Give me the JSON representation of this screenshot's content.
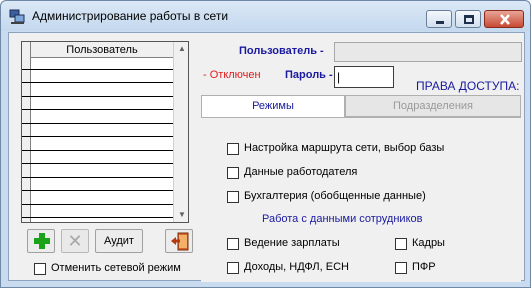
{
  "window": {
    "title": "Администрирование работы в сети"
  },
  "grid": {
    "header": "Пользователь",
    "row_count": 12
  },
  "toolbar": {
    "audit_label": "Аудит"
  },
  "disable_network": {
    "label": "Отменить сетевой режим",
    "checked": false
  },
  "user": {
    "label": "Пользователь -",
    "value": ""
  },
  "status": {
    "text": "- Отключен"
  },
  "password": {
    "label": "Пароль -",
    "value": "|"
  },
  "access": {
    "title": "ПРАВА ДОСТУПА:"
  },
  "tabs": [
    {
      "label": "Режимы",
      "active": true
    },
    {
      "label": "Подразделения",
      "active": false
    }
  ],
  "modes": {
    "items": [
      {
        "label": "Настройка маршрута сети, выбор базы",
        "checked": false
      },
      {
        "label": "Данные работодателя",
        "checked": false
      },
      {
        "label": "Бухгалтерия (обобщенные данные)",
        "checked": false
      }
    ],
    "section": "Работа с данными сотрудников",
    "left": [
      {
        "label": "Ведение зарплаты",
        "checked": false
      },
      {
        "label": "Доходы, НДФЛ, ЕСН",
        "checked": false
      }
    ],
    "right": [
      {
        "label": "Кадры",
        "checked": false
      },
      {
        "label": "ПФР",
        "checked": false
      }
    ]
  },
  "colors": {
    "accent": "#1a1aa0",
    "status": "#e01b1b",
    "add": "#1aa31a"
  },
  "icons": [
    "app-icon",
    "minimize-icon",
    "maximize-icon",
    "close-icon",
    "add-icon",
    "delete-icon",
    "exit-icon",
    "scroll-up-icon",
    "scroll-down-icon"
  ]
}
